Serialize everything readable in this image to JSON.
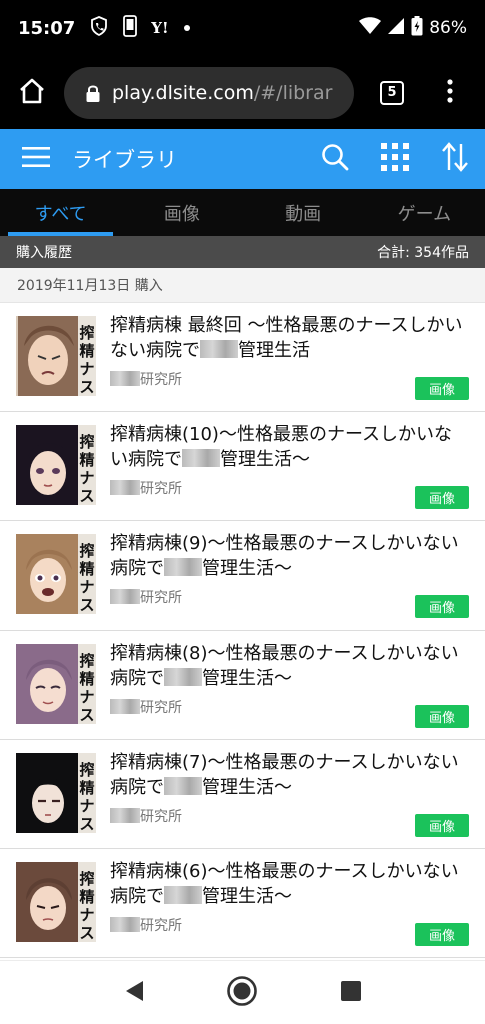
{
  "status_bar": {
    "time": "15:07",
    "yahoo_mark": "Y!",
    "battery": "86%",
    "icons": [
      "shield-phone-icon",
      "phone-icon",
      "yahoo-icon",
      "dot-icon",
      "wifi-icon",
      "signal-icon",
      "battery-icon"
    ]
  },
  "browser": {
    "url_host": "play.dlsite.com",
    "url_path": "/#/librar",
    "tab_count": "5"
  },
  "app_header": {
    "title": "ライブラリ",
    "accent_color": "#2e9cf2"
  },
  "category_tabs": [
    {
      "label": "すべて",
      "active": true
    },
    {
      "label": "画像",
      "active": false
    },
    {
      "label": "動画",
      "active": false
    },
    {
      "label": "ゲーム",
      "active": false
    }
  ],
  "purchase_history": {
    "label": "購入履歴",
    "total": "合計: 354作品"
  },
  "date_group": {
    "label": "2019年11月13日 購入"
  },
  "items": [
    {
      "title_pre": "搾精病棟 最終回 ～性格最悪のナースしかいない病院で",
      "title_post": "管理生活",
      "circle": "研究所",
      "badge": "画像",
      "badge_color": "#1bc25b"
    },
    {
      "title_pre": "搾精病棟(10)～性格最悪のナースしかいない病院で",
      "title_post": "管理生活～",
      "circle": "研究所",
      "badge": "画像",
      "badge_color": "#1bc25b"
    },
    {
      "title_pre": "搾精病棟(9)～性格最悪のナースしかいない病院で",
      "title_post": "管理生活～",
      "circle": "研究所",
      "badge": "画像",
      "badge_color": "#1bc25b"
    },
    {
      "title_pre": "搾精病棟(8)～性格最悪のナースしかいない病院で",
      "title_post": "管理生活～",
      "circle": "研究所",
      "badge": "画像",
      "badge_color": "#1bc25b"
    },
    {
      "title_pre": "搾精病棟(7)～性格最悪のナースしかいない病院で",
      "title_post": "管理生活～",
      "circle": "研究所",
      "badge": "画像",
      "badge_color": "#1bc25b"
    },
    {
      "title_pre": "搾精病棟(6)～性格最悪のナースしかいない病院で",
      "title_post": "管理生活～",
      "circle": "研究所",
      "badge": "画像",
      "badge_color": "#1bc25b"
    }
  ],
  "thumbnail_text": "搾精ナース",
  "nav_icons": [
    "back-icon",
    "home-circle-icon",
    "recents-icon"
  ]
}
